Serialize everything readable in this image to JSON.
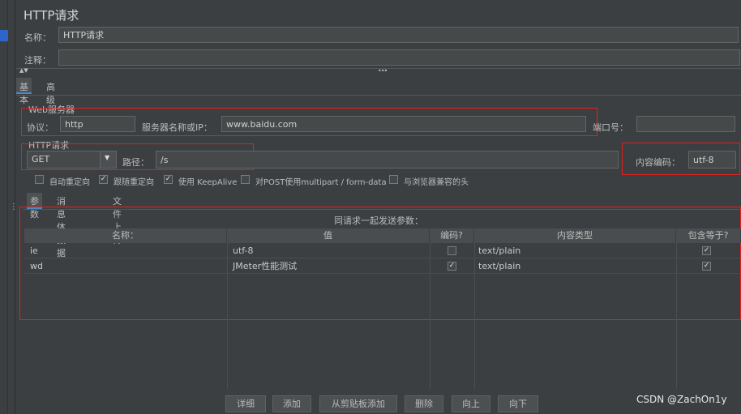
{
  "header": {
    "title": "HTTP请求",
    "name_label": "名称：",
    "name_value": "HTTP请求",
    "comment_label": "注释：",
    "comment_value": ""
  },
  "tabs": [
    "基本",
    "高级"
  ],
  "web_server": {
    "legend": "Web服务器",
    "protocol_label": "协议：",
    "protocol_value": "http",
    "server_label": "服务器名称或IP：",
    "server_value": "www.baidu.com",
    "port_label": "端口号：",
    "port_value": ""
  },
  "http_request": {
    "legend": "HTTP请求",
    "method": "GET",
    "path_label": "路径：",
    "path_value": "/s",
    "encoding_label": "内容编码：",
    "encoding_value": "utf-8"
  },
  "options": [
    {
      "label": "自动重定向",
      "checked": false
    },
    {
      "label": "跟随重定向",
      "checked": true
    },
    {
      "label": "使用 KeepAlive",
      "checked": true
    },
    {
      "label": "对POST使用multipart / form-data",
      "checked": false
    },
    {
      "label": "与浏览器兼容的头",
      "checked": false
    }
  ],
  "sub_tabs": [
    "参数",
    "消息体数据",
    "文件上传"
  ],
  "params": {
    "title": "同请求一起发送参数：",
    "columns": [
      "名称：",
      "值",
      "编码?",
      "内容类型",
      "包含等于?"
    ],
    "rows": [
      {
        "name": "ie",
        "value": "utf-8",
        "encode": false,
        "content_type": "text/plain",
        "include_equals": true
      },
      {
        "name": "wd",
        "value": "JMeter性能测试",
        "encode": true,
        "content_type": "text/plain",
        "include_equals": true
      }
    ]
  },
  "buttons": [
    "详细",
    "添加",
    "从剪贴板添加",
    "删除",
    "向上",
    "向下"
  ],
  "watermark": "CSDN @ZachOn1y",
  "colors": {
    "background": "#3c3f41",
    "field": "#45494a",
    "highlight_box": "#e02020",
    "tab_accent": "#4a88c7"
  }
}
